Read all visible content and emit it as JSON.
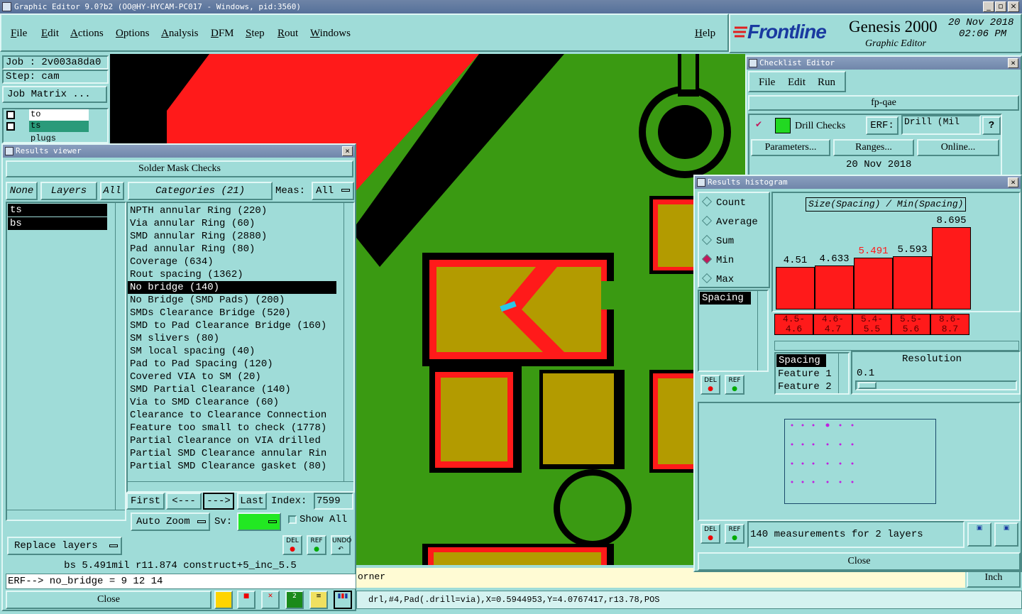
{
  "window_title": "Graphic Editor 9.0?b2 (OO@HY-HYCAM-PC017 - Windows, pid:3560)",
  "menu": [
    "File",
    "Edit",
    "Actions",
    "Options",
    "Analysis",
    "DFM",
    "Step",
    "Rout",
    "Windows"
  ],
  "help": "Help",
  "brand": {
    "logo": "Frontline",
    "product": "Genesis 2000",
    "subtitle": "Graphic Editor",
    "date": "20 Nov 2018",
    "time": "02:06 PM"
  },
  "job": {
    "job_label": "Job : 2v003a8da0",
    "step_label": "Step: cam",
    "matrix_btn": "Job Matrix ..."
  },
  "layers_mini": [
    "to",
    "ts",
    "plugs"
  ],
  "results_viewer": {
    "title": "Results viewer",
    "heading": "Solder Mask Checks",
    "none_btn": "None",
    "layers_btn": "Layers",
    "all_btn": "All",
    "categories_btn": "Categories (21)",
    "meas_label": "Meas:",
    "meas_value": "All",
    "layers": [
      "ts",
      "bs"
    ],
    "categories": [
      "NPTH annular Ring (220)",
      "Via annular Ring (60)",
      "SMD annular Ring (2880)",
      "Pad annular Ring (80)",
      "Coverage (634)",
      "Rout spacing (1362)",
      "No bridge (140)",
      "No Bridge (SMD Pads) (200)",
      "SMDs Clearance Bridge (520)",
      "SMD to Pad Clearance Bridge (160)",
      "SM slivers (80)",
      "SM local spacing (40)",
      "Pad to Pad Spacing (120)",
      "Covered VIA to SM (20)",
      "SMD Partial Clearance (140)",
      "Via to SMD Clearance (60)",
      "Clearance to Clearance Connection",
      "Feature too small to check (1778)",
      "Partial Clearance on VIA drilled",
      "Partial SMD Clearance annular Rin",
      "Partial SMD Clearance gasket (80)"
    ],
    "selected_category": 6,
    "first_btn": "First",
    "prev_btn": "<---",
    "next_btn": "--->",
    "last_btn": "Last",
    "index_label": "Index:",
    "index_value": "7599",
    "auto_zoom": "Auto Zoom",
    "sv_label": "Sv:",
    "show_all": "Show All",
    "replace_layers": "Replace layers",
    "del": "DEL",
    "ref": "REF",
    "undo": "UNDO",
    "status": "bs 5.491mil   r11.874   construct+5_inc_5.5",
    "erf_line": "ERF--> no_bridge = 9 12 14",
    "close": "Close"
  },
  "checklist": {
    "title": "Checklist Editor",
    "menu": [
      "File",
      "Edit",
      "Run"
    ],
    "name": "fp-qae",
    "check_name": "Drill Checks",
    "erf_label": "ERF:",
    "erf_value": "Drill (Mil",
    "params_btn": "Parameters...",
    "ranges_btn": "Ranges...",
    "online_btn": "Online...",
    "date": "20 Nov 2018"
  },
  "histogram": {
    "title": "Results histogram",
    "modes": [
      "Count",
      "Average",
      "Sum",
      "Min",
      "Max"
    ],
    "selected_mode": "Min",
    "attr_list": [
      "Spacing"
    ],
    "chart_title": "Size(Spacing) / Min(Spacing)",
    "sort_list": [
      "Spacing",
      "Feature 1",
      "Feature 2"
    ],
    "resolution_label": "Resolution",
    "resolution_value": "0.1",
    "summary": "140 measurements for 2 layers",
    "close": "Close",
    "del": "DEL",
    "ref": "REF",
    "chart_data": {
      "type": "bar",
      "categories": [
        "4.5-4.6",
        "4.6-4.7",
        "5.4-5.5",
        "5.5-5.6",
        "8.6-8.7"
      ],
      "values": [
        4.51,
        4.633,
        5.491,
        5.593,
        8.695
      ],
      "value_labels": [
        "4.51",
        "4.633",
        "5.491",
        "5.593",
        "8.695"
      ],
      "highlight_index": 2,
      "highlight_color": "#ff1a1a",
      "bar_color": "#ff1a1a",
      "ylim": [
        0,
        8.695
      ]
    }
  },
  "bottom": {
    "corner_text": "orner",
    "units": "Inch",
    "coords": "drl,#4,Pad(.drill=via),X=0.5944953,Y=4.0767417,r13.78,POS"
  },
  "colors": {
    "background": "#9fdcd8",
    "board_green": "#3a9a12",
    "copper_red": "#ff1a1a",
    "mask_yellow": "#b39b00"
  }
}
